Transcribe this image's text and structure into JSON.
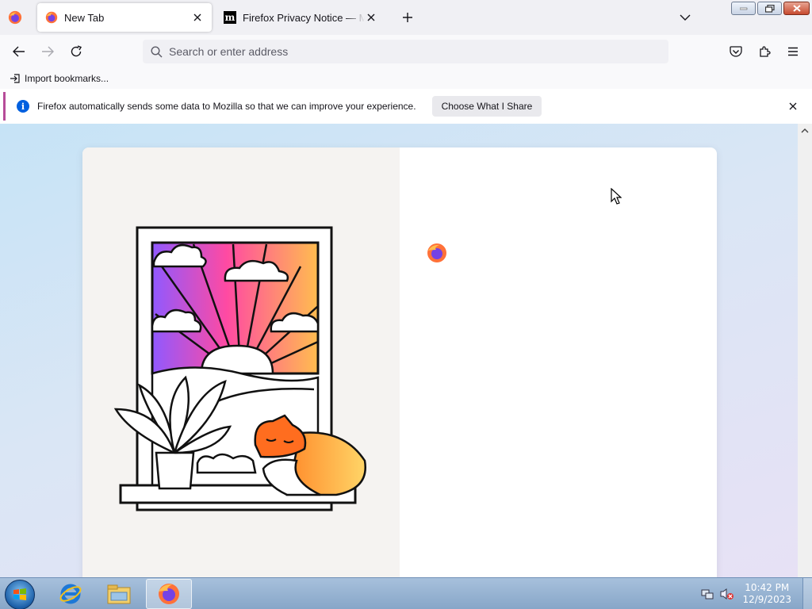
{
  "tabs": {
    "active": {
      "title": "New Tab",
      "icon": "firefox-icon"
    },
    "inactive": {
      "title": "Firefox Privacy Notice — Mozilla",
      "icon": "mozilla-m-icon",
      "favicon_glyph": "m"
    }
  },
  "urlbar": {
    "placeholder": "Search or enter address"
  },
  "bookmarks": {
    "import_label": "Import bookmarks..."
  },
  "notification": {
    "message": "Firefox automatically sends some data to Mozilla so that we can improve your experience.",
    "button_label": "Choose What I Share",
    "accent": "#b74c99"
  },
  "taskbar": {
    "time": "10:42 PM",
    "date": "12/9/2023",
    "apps": [
      "internet-explorer-icon",
      "file-explorer-icon",
      "firefox-icon"
    ]
  },
  "colors": {
    "primary": "#0060df",
    "content_bg": "#c6e3f6"
  }
}
